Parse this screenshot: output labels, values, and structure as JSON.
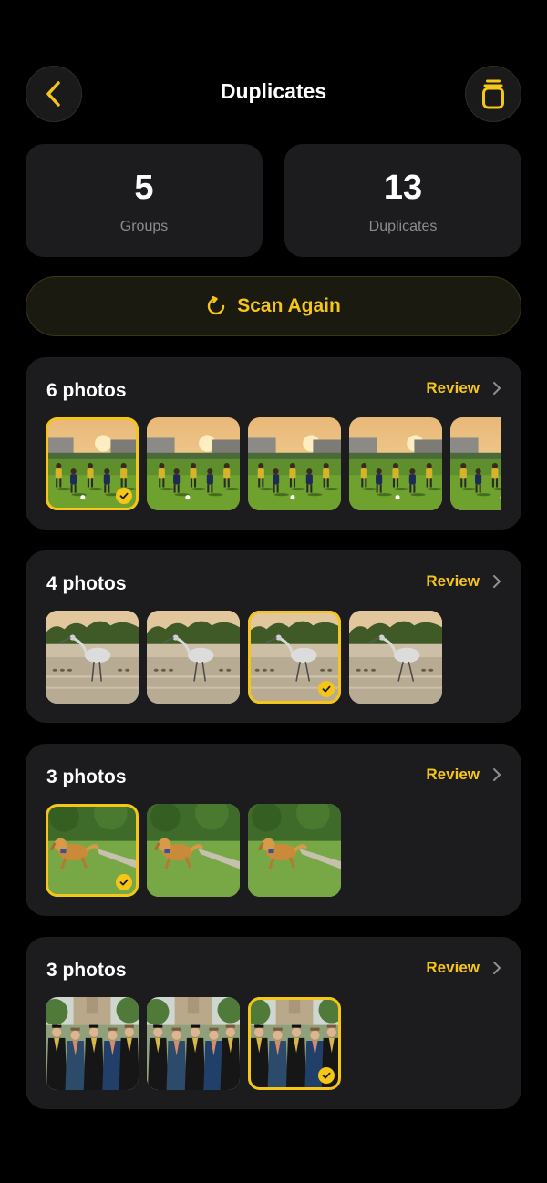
{
  "header": {
    "title": "Duplicates",
    "back_icon": "chevron-left-icon",
    "trash_icon": "trash-icon"
  },
  "stats": {
    "groups": {
      "value": "5",
      "label": "Groups"
    },
    "duplicates": {
      "value": "13",
      "label": "Duplicates"
    }
  },
  "scan": {
    "label": "Scan Again",
    "icon": "refresh-icon"
  },
  "colors": {
    "accent": "#f5c518",
    "background": "#000000",
    "card": "#1c1c1e"
  },
  "groups": [
    {
      "count_label": "6 photos",
      "review_label": "Review",
      "scene": "soccer",
      "photos": 5,
      "selected_index": 0
    },
    {
      "count_label": "4 photos",
      "review_label": "Review",
      "scene": "heron",
      "photos": 4,
      "selected_index": 2
    },
    {
      "count_label": "3 photos",
      "review_label": "Review",
      "scene": "dog",
      "photos": 3,
      "selected_index": 0
    },
    {
      "count_label": "3 photos",
      "review_label": "Review",
      "scene": "graduation",
      "photos": 3,
      "selected_index": 2
    }
  ]
}
